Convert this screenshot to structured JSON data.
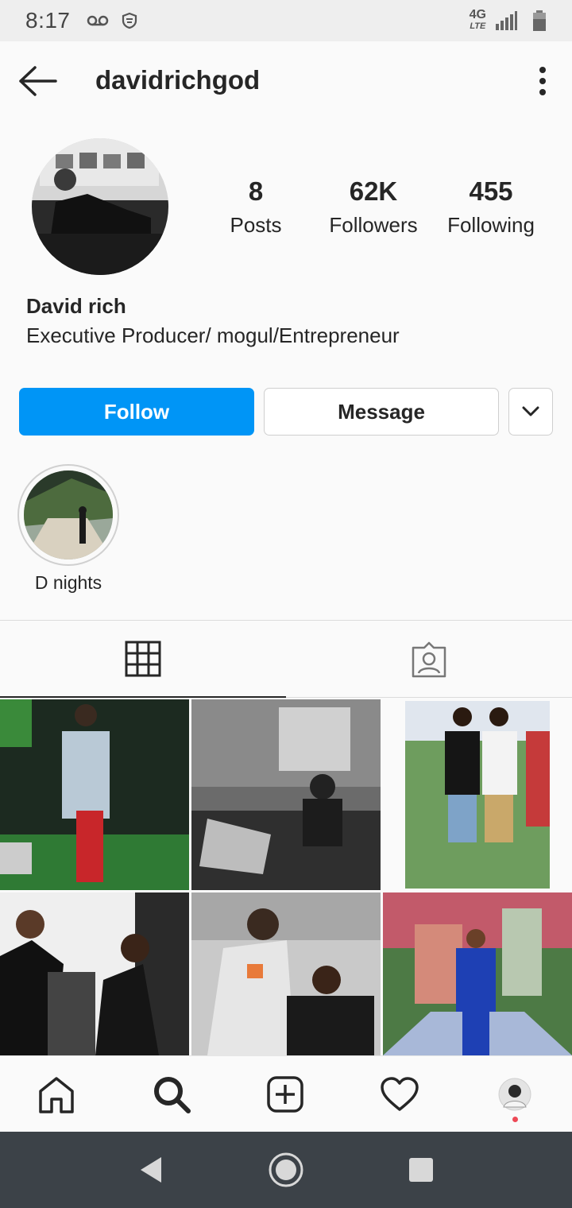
{
  "status_bar": {
    "time": "8:17",
    "icons": [
      "voicemail-icon",
      "vpn-shield-icon"
    ],
    "network": "4G",
    "network_sub": "LTE",
    "right_icons": [
      "signal-icon",
      "battery-icon"
    ]
  },
  "header": {
    "username": "davidrichgod",
    "back_icon": "back-arrow-icon",
    "more_icon": "more-vertical-icon"
  },
  "profile": {
    "stats": [
      {
        "value": "8",
        "label": "Posts"
      },
      {
        "value": "62K",
        "label": "Followers"
      },
      {
        "value": "455",
        "label": "Following"
      }
    ],
    "full_name": "David rich",
    "bio": "Executive Producer/ mogul/Entrepreneur"
  },
  "actions": {
    "follow_label": "Follow",
    "message_label": "Message",
    "dropdown_icon": "chevron-down-icon",
    "follow_color": "#0095f6"
  },
  "highlights": [
    {
      "label": "D nights"
    }
  ],
  "tabs": [
    {
      "icon": "grid-icon",
      "active": true
    },
    {
      "icon": "tagged-icon",
      "active": false
    }
  ],
  "grid_posts": [
    {
      "colors": [
        "#1d3a24",
        "#2f7a34",
        "#c9d6e0"
      ]
    },
    {
      "colors": [
        "#5a5a5a",
        "#2b2b2b",
        "#a8a8a8"
      ]
    },
    {
      "colors": [
        "#6b9e5a",
        "#f2f2f2",
        "#c53a3a"
      ]
    },
    {
      "colors": [
        "#f0f0f0",
        "#1a1a1a",
        "#5c5c5c"
      ]
    },
    {
      "colors": [
        "#c7c7c7",
        "#3a3a3a",
        "#8a8a8a"
      ]
    },
    {
      "colors": [
        "#3f7d3a",
        "#1e40b4",
        "#e07a8a"
      ]
    }
  ],
  "bottom_nav": [
    {
      "icon": "home-icon"
    },
    {
      "icon": "search-icon"
    },
    {
      "icon": "add-post-icon"
    },
    {
      "icon": "heart-icon"
    },
    {
      "icon": "profile-avatar-icon"
    }
  ],
  "system_nav": [
    "back-triangle-icon",
    "home-circle-icon",
    "recents-square-icon"
  ]
}
